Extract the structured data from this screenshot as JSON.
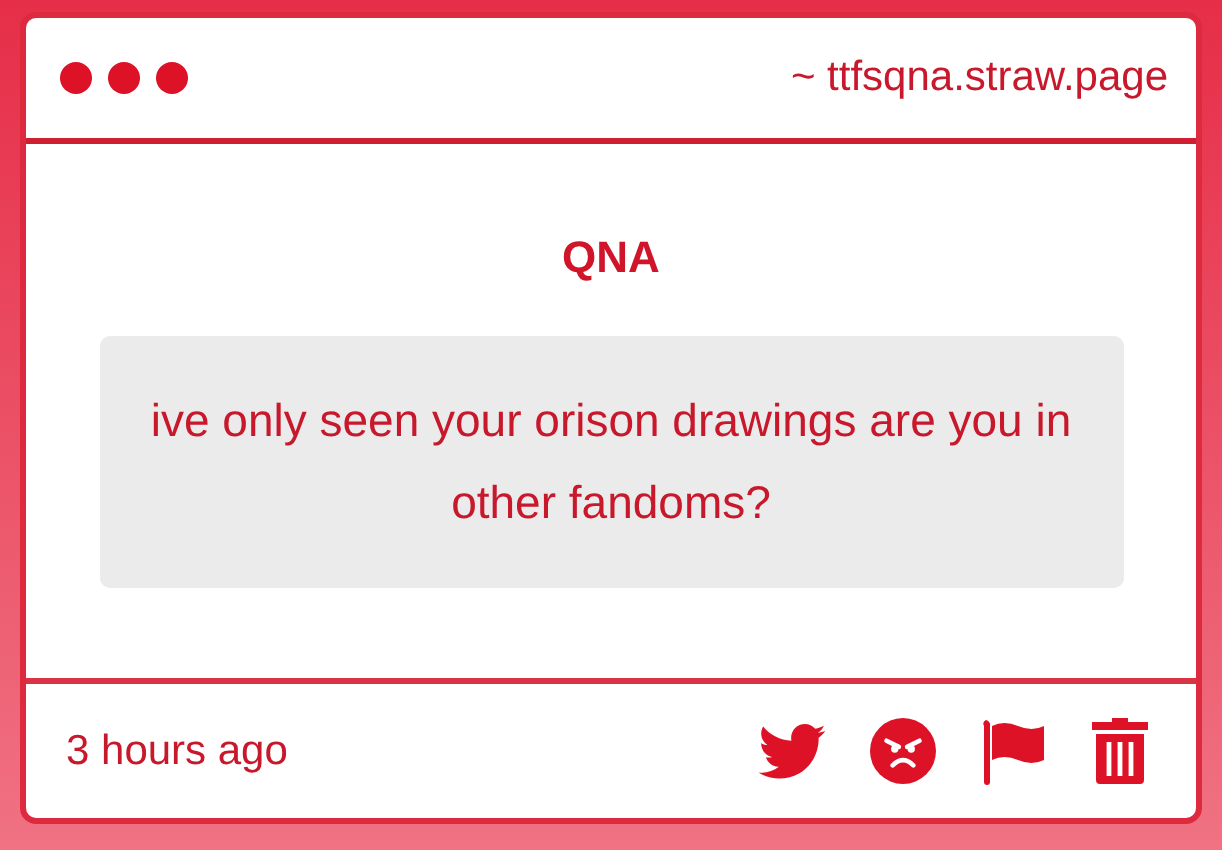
{
  "window": {
    "address": "~ ttfsqna.straw.page"
  },
  "heading": "QNA",
  "question": "ive only seen your orison drawings are you in other fandoms?",
  "footer": {
    "time": "3 hours ago"
  }
}
